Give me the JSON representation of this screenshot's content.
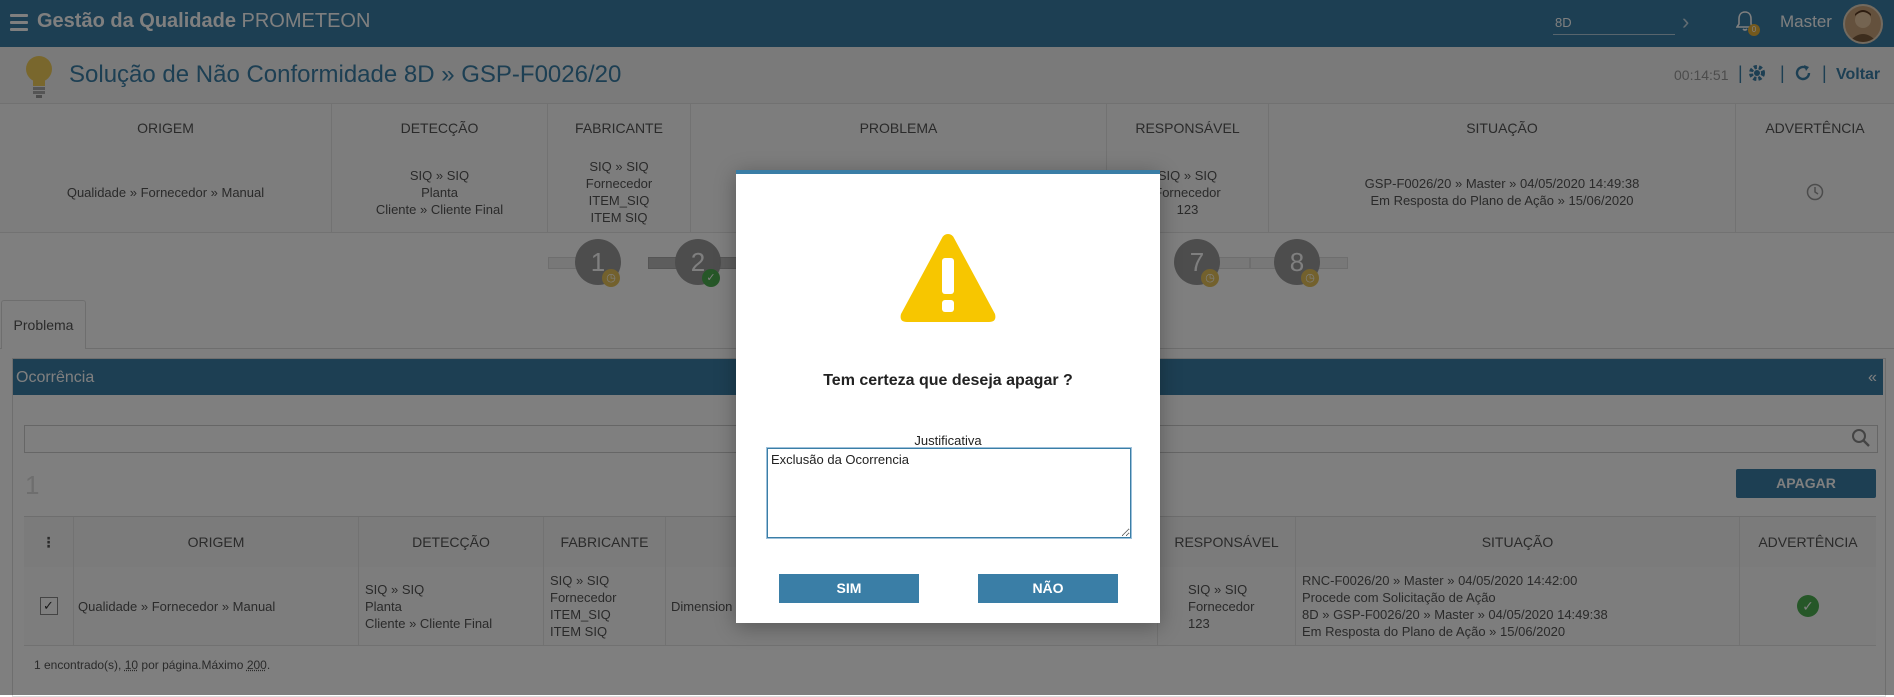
{
  "app": {
    "title_bold": "Gestão da Qualidade",
    "title_brand": "PROMETEON"
  },
  "topbar": {
    "module_value": "8D",
    "user_name": "Master",
    "notification_count": "0"
  },
  "page": {
    "title": "Solução de Não Conformidade 8D » GSP-F0026/20",
    "timer": "00:14:51",
    "back_label": "Voltar"
  },
  "summary": {
    "headers": [
      "ORIGEM",
      "DETECÇÃO",
      "FABRICANTE",
      "PROBLEMA",
      "RESPONSÁVEL",
      "SITUAÇÃO",
      "ADVERTÊNCIA"
    ],
    "row": {
      "origem": "Qualidade » Fornecedor » Manual",
      "deteccao": [
        "SIQ » SIQ",
        "Planta",
        "Cliente » Cliente Final"
      ],
      "fabricante": [
        "SIQ » SIQ",
        "Fornecedor",
        "ITEM_SIQ",
        "ITEM SIQ"
      ],
      "responsavel": [
        "SIQ » SIQ",
        "Fornecedor",
        "123"
      ],
      "situacao": [
        "GSP-F0026/20 » Master » 04/05/2020 14:49:38",
        "Em Resposta do Plano de Ação » 15/06/2020"
      ]
    }
  },
  "steps": [
    "1",
    "2",
    "7",
    "8"
  ],
  "tabs": {
    "problema": "Problema"
  },
  "panel": {
    "title": "Ocorrência",
    "collapse": "«",
    "count": "1",
    "delete_label": "APAGAR"
  },
  "grid": {
    "menu_glyph": "⋮",
    "headers": [
      "ORIGEM",
      "DETECÇÃO",
      "FABRICANTE",
      "RESPONSÁVEL",
      "SITUAÇÃO",
      "ADVERTÊNCIA"
    ],
    "row": {
      "origem": "Qualidade » Fornecedor » Manual",
      "deteccao": [
        "SIQ » SIQ",
        "Planta",
        "Cliente » Cliente Final"
      ],
      "fabricante": [
        "SIQ » SIQ",
        "Fornecedor",
        "ITEM_SIQ",
        "ITEM SIQ"
      ],
      "problema": "Dimension",
      "responsavel": [
        "SIQ » SIQ",
        "Fornecedor",
        "123"
      ],
      "situacao": [
        "RNC-F0026/20 » Master » 04/05/2020 14:42:00",
        "Procede com Solicitação de Ação",
        "8D » GSP-F0026/20 » Master » 04/05/2020 14:49:38",
        "Em Resposta do Plano de Ação » 15/06/2020"
      ]
    },
    "footer": {
      "prefix": "1 encontrado(s), ",
      "per_page": "10",
      "mid": " por página.Máximo ",
      "max": "200",
      "suffix": "."
    }
  },
  "modal": {
    "question": "Tem certeza que deseja apagar ?",
    "justificativa_label": "Justificativa",
    "justificativa_value": "Exclusão da Ocorrencia",
    "yes_label": "SIM",
    "no_label": "NÃO"
  },
  "colors": {
    "primary": "#3a7ea6",
    "warning": "#f7c600",
    "success": "#4caf50",
    "step_badge": "#e7c35a"
  }
}
